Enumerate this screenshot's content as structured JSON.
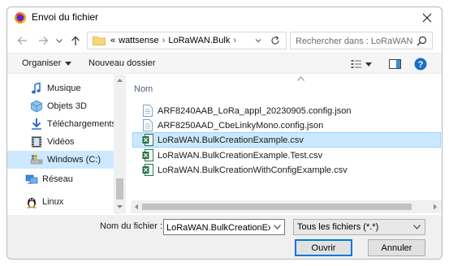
{
  "window": {
    "title": "Envoi du fichier",
    "close_label": "×"
  },
  "address": {
    "prefix": "«",
    "crumbs": [
      "wattsense",
      "LoRaWAN.Bulk"
    ],
    "separator": "›",
    "search_placeholder": "Rechercher dans : LoRaWAN...."
  },
  "toolbar": {
    "organize_label": "Organiser",
    "new_folder_label": "Nouveau dossier",
    "help_label": "?"
  },
  "sidebar": {
    "items": [
      {
        "label": "Musique",
        "icon": "music-icon",
        "selected": false
      },
      {
        "label": "Objets 3D",
        "icon": "3d-objects-icon",
        "selected": false
      },
      {
        "label": "Téléchargements",
        "icon": "downloads-icon",
        "selected": false
      },
      {
        "label": "Vidéos",
        "icon": "videos-icon",
        "selected": false
      },
      {
        "label": "Windows (C:)",
        "icon": "drive-icon",
        "selected": true
      },
      {
        "label": "Réseau",
        "icon": "network-icon",
        "selected": false
      },
      {
        "label": "Linux",
        "icon": "linux-icon",
        "selected": false
      }
    ]
  },
  "files": {
    "column_name": "Nom",
    "items": [
      {
        "name": "ARF8240AAB_LoRa_appl_20230905.config.json",
        "type": "json",
        "selected": false
      },
      {
        "name": "ARF8250AAD_CbeLinkyMono.config.json",
        "type": "json",
        "selected": false
      },
      {
        "name": "LoRaWAN.BulkCreationExample.csv",
        "type": "csv",
        "selected": true
      },
      {
        "name": "LoRaWAN.BulkCreationExample.Test.csv",
        "type": "csv",
        "selected": false
      },
      {
        "name": "LoRaWAN.BulkCreationWithConfigExample.csv",
        "type": "csv",
        "selected": false
      }
    ]
  },
  "footer": {
    "filename_label": "Nom du fichier :",
    "filename_value": "LoRaWAN.BulkCreationExar",
    "filetype_value": "Tous les fichiers (*.*)",
    "open_label": "Ouvrir",
    "cancel_label": "Annuler"
  },
  "colors": {
    "accent": "#0078d7",
    "selection": "#cce8ff",
    "folder": "#f8d775"
  }
}
